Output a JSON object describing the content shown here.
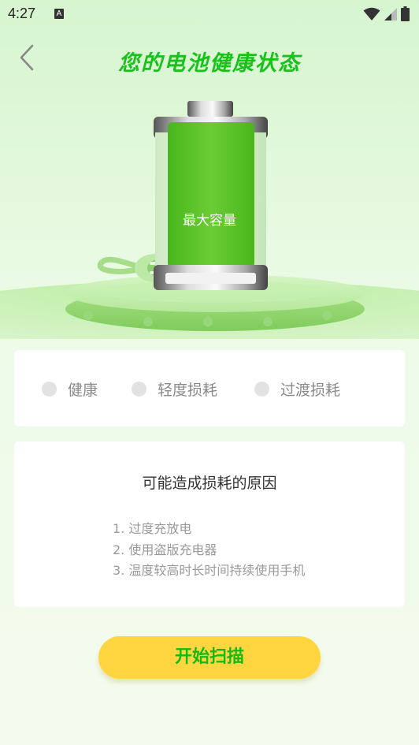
{
  "status_bar": {
    "time": "4:27",
    "notification_letter": "A",
    "icons": [
      "wifi-icon",
      "signal-icon",
      "battery-icon"
    ]
  },
  "header": {
    "title": "您的电池健康状态"
  },
  "battery": {
    "label": "最大容量"
  },
  "status_options": [
    {
      "label": "健康"
    },
    {
      "label": "轻度损耗"
    },
    {
      "label": "过渡损耗"
    }
  ],
  "reasons": {
    "title": "可能造成损耗的原因",
    "items": [
      "1. 过度充放电",
      "2. 使用盗版充电器",
      "3. 温度较高时长时间持续使用手机"
    ]
  },
  "action": {
    "scan_label": "开始扫描"
  },
  "colors": {
    "accent_green": "#19c21a",
    "button_yellow": "#ffd63f"
  }
}
